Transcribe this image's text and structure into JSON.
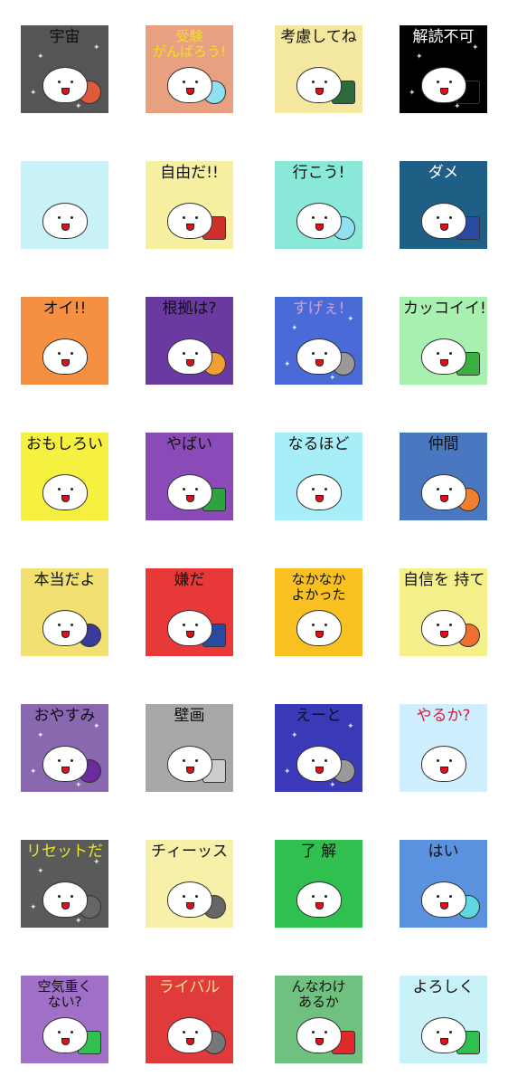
{
  "stickers": [
    {
      "caption": "宇宙",
      "bg": "#555555",
      "fg": "#111111",
      "prop": "#e05a3a",
      "propShape": "round"
    },
    {
      "caption": "受験 がんばろう!",
      "bg": "#e8a080",
      "fg": "#f2e020",
      "prop": "#8fe0f0",
      "propShape": "round"
    },
    {
      "caption": "考慮してね",
      "bg": "#f4e8a0",
      "fg": "#111111",
      "prop": "#2e6b3a",
      "propShape": "square"
    },
    {
      "caption": "解読不可",
      "bg": "#000000",
      "fg": "#ffffff",
      "prop": "#000000",
      "propShape": "square"
    },
    {
      "caption": "",
      "bg": "#c8f2f8",
      "fg": "#111111",
      "prop": null,
      "propShape": "round"
    },
    {
      "caption": "自由だ!!",
      "bg": "#f6f0a0",
      "fg": "#111111",
      "prop": "#d0302a",
      "propShape": "square"
    },
    {
      "caption": "行こう!",
      "bg": "#8ae8d8",
      "fg": "#111111",
      "prop": "#8fe0f0",
      "propShape": "round"
    },
    {
      "caption": "ダメ",
      "bg": "#1f5f86",
      "fg": "#ffffff",
      "prop": "#2a4aa0",
      "propShape": "square"
    },
    {
      "caption": "オイ!!",
      "bg": "#f59042",
      "fg": "#111111",
      "prop": null,
      "propShape": "round"
    },
    {
      "caption": "根拠は?",
      "bg": "#6a3aa0",
      "fg": "#111111",
      "prop": "#f0a030",
      "propShape": "round"
    },
    {
      "caption": "すげぇ!",
      "bg": "#4a6ad8",
      "fg": "#d0a0d0",
      "prop": "#999999",
      "propShape": "round"
    },
    {
      "caption": "カッコイイ!",
      "bg": "#a8f0b0",
      "fg": "#111111",
      "prop": "#3ab040",
      "propShape": "square"
    },
    {
      "caption": "おもしろい",
      "bg": "#f6f040",
      "fg": "#111111",
      "prop": null,
      "propShape": "round"
    },
    {
      "caption": "やばい",
      "bg": "#8a4ab8",
      "fg": "#111111",
      "prop": "#30a040",
      "propShape": "square"
    },
    {
      "caption": "なるほど",
      "bg": "#a8eef8",
      "fg": "#111111",
      "prop": null,
      "propShape": "round"
    },
    {
      "caption": "仲間",
      "bg": "#4a78c0",
      "fg": "#111111",
      "prop": "#f08030",
      "propShape": "round"
    },
    {
      "caption": "本当だよ",
      "bg": "#f2e070",
      "fg": "#111111",
      "prop": "#3a3a9a",
      "propShape": "round"
    },
    {
      "caption": "嫌だ",
      "bg": "#e83838",
      "fg": "#111111",
      "prop": "#2a4aa0",
      "propShape": "square"
    },
    {
      "caption": "なかなか よかった",
      "bg": "#f8c020",
      "fg": "#111111",
      "prop": null,
      "propShape": "round"
    },
    {
      "caption": "自信を 持て",
      "bg": "#f6f08a",
      "fg": "#111111",
      "prop": "#f07030",
      "propShape": "round"
    },
    {
      "caption": "おやすみ",
      "bg": "#8a68b0",
      "fg": "#111111",
      "prop": "#6a2aa0",
      "propShape": "round"
    },
    {
      "caption": "壁画",
      "bg": "#a8a8a8",
      "fg": "#111111",
      "prop": "#cccccc",
      "propShape": "square"
    },
    {
      "caption": "えーと",
      "bg": "#3a3ab8",
      "fg": "#111111",
      "prop": "#999999",
      "propShape": "round"
    },
    {
      "caption": "やるか?",
      "bg": "#cfeefe",
      "fg": "#d02040",
      "prop": null,
      "propShape": "round"
    },
    {
      "caption": "リセットだ",
      "bg": "#5a5a5a",
      "fg": "#e8e820",
      "prop": "#666666",
      "propShape": "round"
    },
    {
      "caption": "チィーッス",
      "bg": "#f6f0a8",
      "fg": "#111111",
      "prop": "#666666",
      "propShape": "round"
    },
    {
      "caption": "了 解",
      "bg": "#2fc050",
      "fg": "#111111",
      "prop": null,
      "propShape": "round"
    },
    {
      "caption": "はい",
      "bg": "#5a92e0",
      "fg": "#111111",
      "prop": "#60d8e0",
      "propShape": "round"
    },
    {
      "caption": "空気重く ない?",
      "bg": "#a070c8",
      "fg": "#111111",
      "prop": "#30c050",
      "propShape": "square"
    },
    {
      "caption": "ライバル",
      "bg": "#e03a3a",
      "fg": "#f6e090",
      "prop": "#777777",
      "propShape": "round"
    },
    {
      "caption": "んなわけ あるか",
      "bg": "#70c080",
      "fg": "#111111",
      "prop": "#e02a2a",
      "propShape": "square"
    },
    {
      "caption": "よろしく",
      "bg": "#c8f2f8",
      "fg": "#111111",
      "prop": "#30c050",
      "propShape": "square"
    }
  ]
}
